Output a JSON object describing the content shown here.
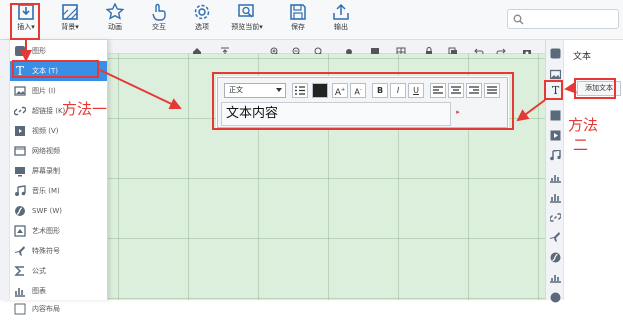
{
  "ribbon": {
    "buttons": [
      {
        "id": "insert",
        "label": "插入",
        "icon": "insert-icon",
        "has_dropdown": true
      },
      {
        "id": "background",
        "label": "背景",
        "icon": "background-icon",
        "has_dropdown": true
      },
      {
        "id": "animation",
        "label": "动画",
        "icon": "animation-icon"
      },
      {
        "id": "interaction",
        "label": "交互",
        "icon": "hand-pointer-icon"
      },
      {
        "id": "options",
        "label": "选项",
        "icon": "gear-icon"
      },
      {
        "id": "preview",
        "label": "预览当前",
        "icon": "preview-icon",
        "has_dropdown": true
      },
      {
        "id": "save",
        "label": "保存",
        "icon": "save-icon"
      },
      {
        "id": "export",
        "label": "输出",
        "icon": "export-icon"
      }
    ]
  },
  "insert_menu": {
    "items": [
      {
        "label": "图形",
        "icon": "shape-icon"
      },
      {
        "label": "文本 (T)",
        "icon": "text-icon",
        "selected": true
      },
      {
        "label": "图片 (I)",
        "icon": "image-icon"
      },
      {
        "label": "超链接 (K)",
        "icon": "link-icon"
      },
      {
        "label": "视频 (V)",
        "icon": "video-icon"
      },
      {
        "label": "网络视频",
        "icon": "web-video-icon"
      },
      {
        "label": "屏幕录制",
        "icon": "screen-record-icon"
      },
      {
        "label": "音乐 (M)",
        "icon": "music-icon"
      },
      {
        "label": "SWF (W)",
        "icon": "swf-icon"
      },
      {
        "label": "艺术图形",
        "icon": "art-shape-icon"
      },
      {
        "label": "特殊符号",
        "icon": "special-symbol-icon"
      },
      {
        "label": "公式",
        "icon": "formula-icon"
      },
      {
        "label": "图表",
        "icon": "chart-icon"
      },
      {
        "label": "内容布局",
        "icon": "layout-icon"
      }
    ]
  },
  "text_editor": {
    "font_select": "正文",
    "content": "文本内容",
    "buttons": [
      "B",
      "I",
      "U"
    ]
  },
  "right_panel": {
    "title": "文本",
    "add_text_button": "添加文本"
  },
  "annotations": {
    "method_one": "方法一",
    "method_two_top": "方法",
    "method_two_bottom": "二"
  },
  "colors": {
    "selected": "#3a8ee6",
    "annotation": "#e53935",
    "canvas": "#dcefdc"
  }
}
